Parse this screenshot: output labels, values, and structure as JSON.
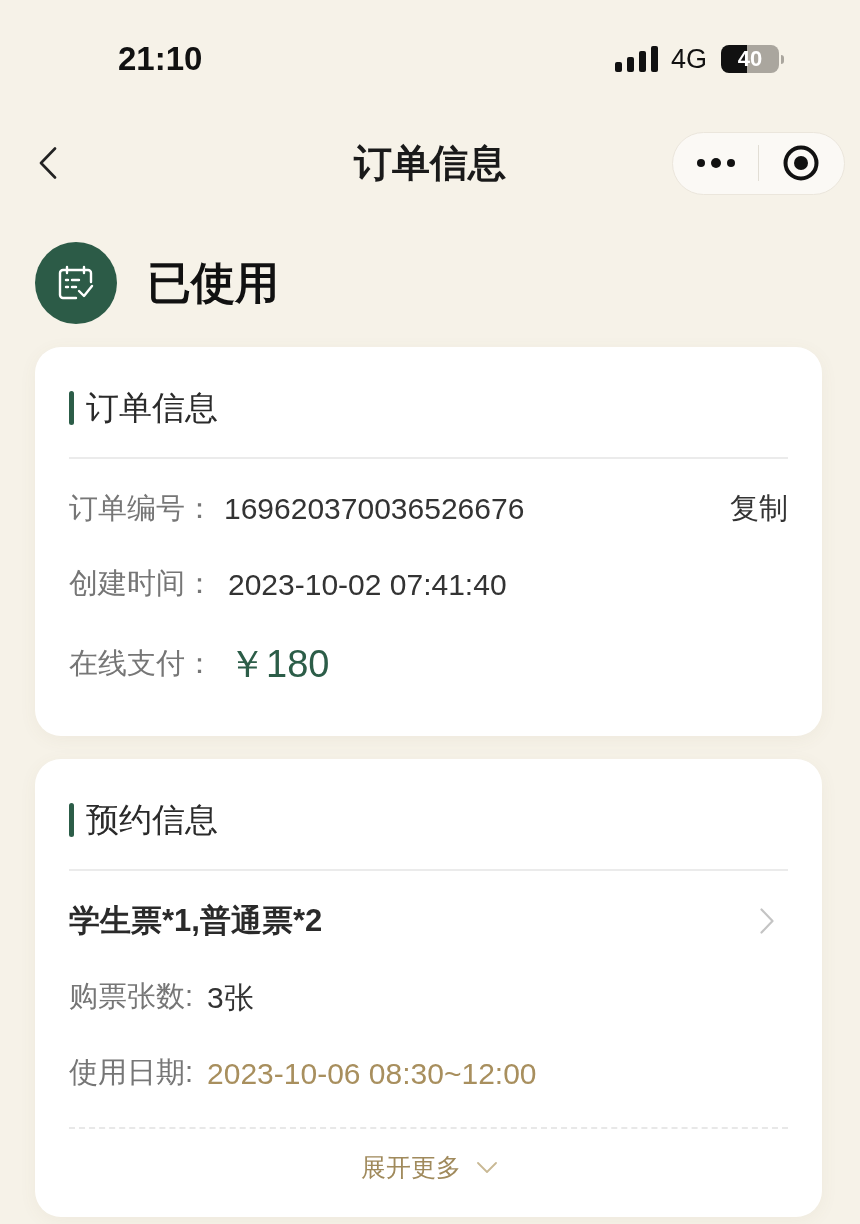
{
  "status_bar": {
    "time": "21:10",
    "network": "4G",
    "battery": "40"
  },
  "nav": {
    "title": "订单信息"
  },
  "status": {
    "label": "已使用"
  },
  "cards": [
    {
      "title": "订单信息",
      "rows": [
        {
          "kind": "copy",
          "label": "订单编号：",
          "value": "169620370036526676",
          "action": "复制"
        },
        {
          "kind": "plain",
          "label": "创建时间：",
          "value": "2023-10-02 07:41:40"
        },
        {
          "kind": "amount",
          "label": "在线支付：",
          "value": "￥180"
        }
      ]
    },
    {
      "title": "预约信息",
      "rows": [
        {
          "kind": "summary",
          "value": "学生票*1,普通票*2"
        },
        {
          "kind": "plain",
          "label": "购票张数:",
          "value": "3张"
        },
        {
          "kind": "highlight",
          "label": "使用日期:",
          "value": "2023-10-06 08:30~12:00"
        }
      ],
      "expand": {
        "label": "展开更多",
        "expanded": false
      }
    }
  ]
}
